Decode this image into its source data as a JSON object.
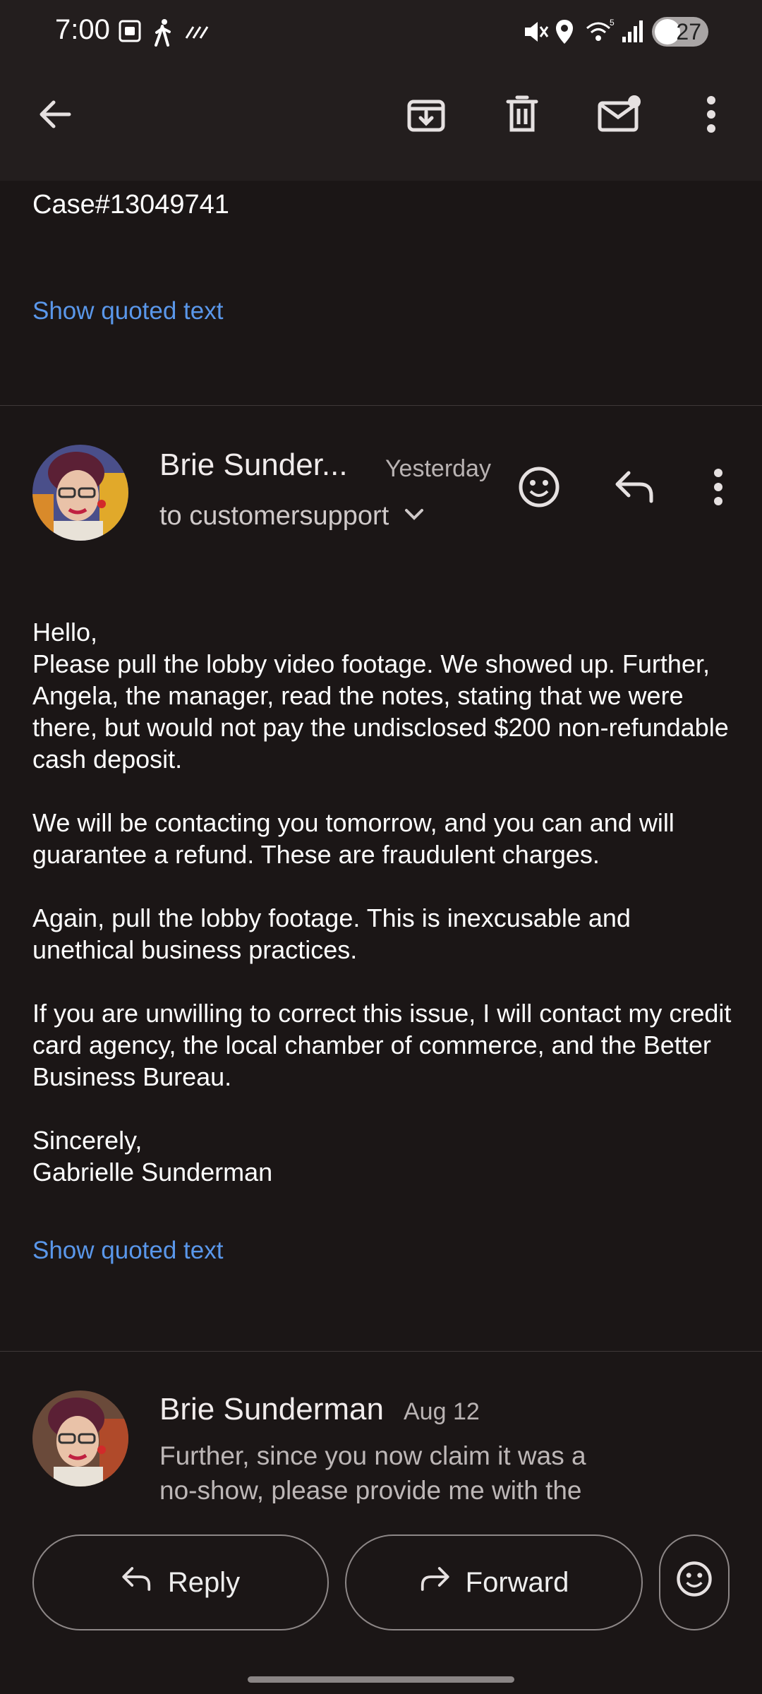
{
  "status_bar": {
    "time": "7:00",
    "battery_level": "27",
    "icons": [
      "screenshot-icon",
      "walking-icon",
      "data-saver-icon",
      "mute-icon",
      "location-icon",
      "wifi-icon",
      "signal-icon",
      "battery-icon"
    ]
  },
  "toolbar": {
    "icons": [
      "back-arrow-icon",
      "archive-icon",
      "trash-icon",
      "mark-unread-icon",
      "more-vert-icon"
    ]
  },
  "previous_message": {
    "case_line": "Case#13049741",
    "show_quoted": "Show quoted text"
  },
  "message": {
    "sender": "Brie Sunder...",
    "date": "Yesterday",
    "recipient": "to customersupport",
    "paragraphs": [
      "Hello,\nPlease pull the lobby video footage. We showed up. Further, Angela, the manager, read the notes, stating that we were there, but would not pay the undisclosed $200 non-refundable cash deposit.",
      "We will be contacting you tomorrow, and you can and will guarantee a refund. These are fraudulent charges.",
      "Again, pull the lobby footage. This is inexcusable and unethical business practices.",
      "If you are unwilling to correct this issue, I will contact my credit card agency, the local chamber of commerce, and the Better Business Bureau.",
      "Sincerely,\nGabrielle Sunderman"
    ],
    "show_quoted": "Show quoted text"
  },
  "collapsed_message": {
    "sender": "Brie Sunderman",
    "date": "Aug 12",
    "snippet_line1": "Further, since you now claim it was a",
    "snippet_line2": "no-show, please provide me with the"
  },
  "actions": {
    "reply_label": "Reply",
    "forward_label": "Forward"
  },
  "colors": {
    "background": "#1b1616",
    "app_bar": "#231e1e",
    "link": "#5a97ea"
  }
}
